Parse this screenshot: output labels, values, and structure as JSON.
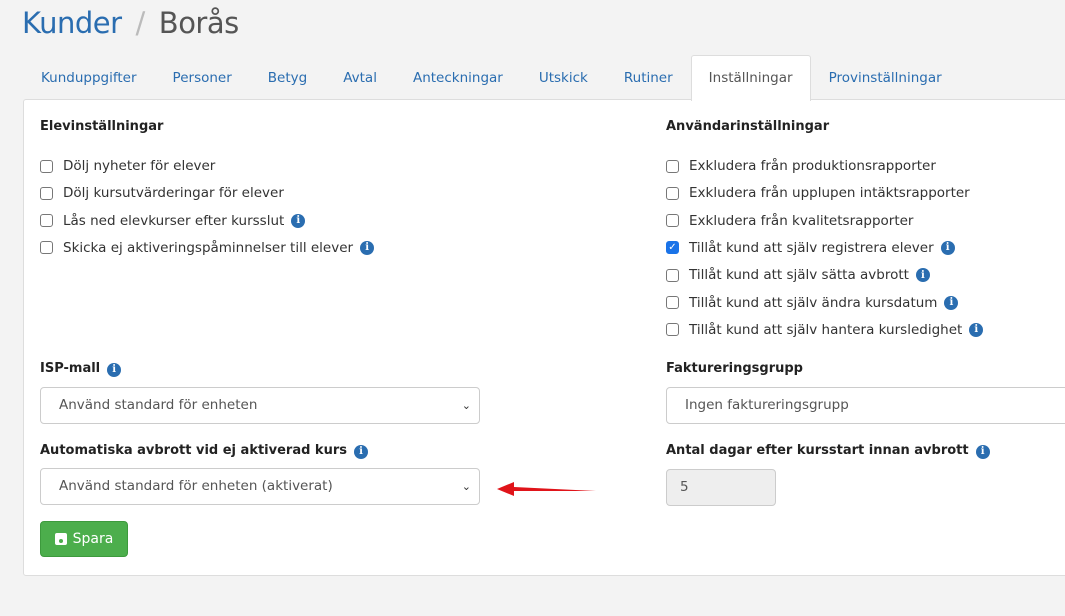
{
  "breadcrumb": {
    "parent": "Kunder",
    "separator": "/",
    "current": "Borås"
  },
  "tabs": [
    "Kunduppgifter",
    "Personer",
    "Betyg",
    "Avtal",
    "Anteckningar",
    "Utskick",
    "Rutiner",
    "Inställningar",
    "Provinställningar"
  ],
  "active_tab": "Inställningar",
  "student_settings": {
    "heading": "Elevinställningar",
    "items": [
      {
        "label": "Dölj nyheter för elever",
        "checked": false,
        "info": false
      },
      {
        "label": "Dölj kursutvärderingar för elever",
        "checked": false,
        "info": false
      },
      {
        "label": "Lås ned elevkurser efter kursslut",
        "checked": false,
        "info": true
      },
      {
        "label": "Skicka ej aktiveringspåminnelser till elever",
        "checked": false,
        "info": true
      }
    ]
  },
  "user_settings": {
    "heading": "Användarinställningar",
    "items": [
      {
        "label": "Exkludera från produktionsrapporter",
        "checked": false,
        "info": false
      },
      {
        "label": "Exkludera från upplupen intäktsrapporter",
        "checked": false,
        "info": false
      },
      {
        "label": "Exkludera från kvalitetsrapporter",
        "checked": false,
        "info": false
      },
      {
        "label": "Tillåt kund att själv registrera elever",
        "checked": true,
        "info": true
      },
      {
        "label": "Tillåt kund att själv sätta avbrott",
        "checked": false,
        "info": true
      },
      {
        "label": "Tillåt kund att själv ändra kursdatum",
        "checked": false,
        "info": true
      },
      {
        "label": "Tillåt kund att själv hantera kursledighet",
        "checked": false,
        "info": true
      }
    ]
  },
  "isp": {
    "label": "ISP-mall",
    "value": "Använd standard för enheten"
  },
  "auto_abort": {
    "label": "Automatiska avbrott vid ej aktiverad kurs",
    "value": "Använd standard för enheten (aktiverat)"
  },
  "billing": {
    "label": "Faktureringsgrupp",
    "value": "Ingen faktureringsgrupp"
  },
  "days": {
    "label": "Antal dagar efter kursstart innan avbrott",
    "value": "5"
  },
  "save_label": "Spara",
  "colors": {
    "link": "#2a6db0",
    "save": "#4cae4c",
    "annotation_arrow": "#e0141a"
  }
}
